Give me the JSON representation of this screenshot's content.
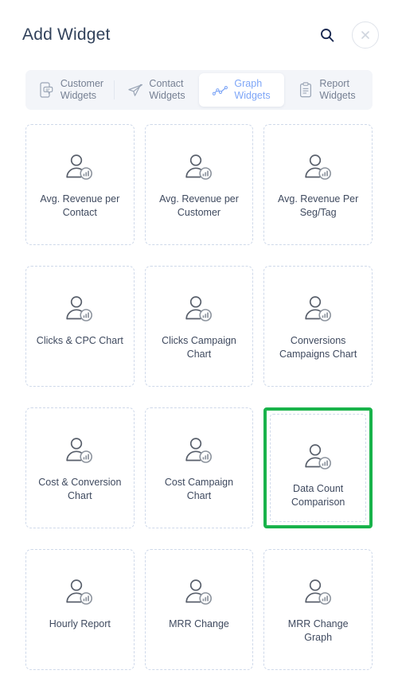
{
  "header": {
    "title": "Add Widget",
    "search_icon": "search-icon",
    "close_icon": "close-icon"
  },
  "tabs": {
    "active_index": 2,
    "items": [
      {
        "label": "Customer\nWidgets",
        "icon": "mobile-chat-icon",
        "active": false
      },
      {
        "label": "Contact\nWidgets",
        "icon": "paper-plane-icon",
        "active": false
      },
      {
        "label": "Graph\nWidgets",
        "icon": "line-chart-icon",
        "active": true
      },
      {
        "label": "Report\nWidgets",
        "icon": "clipboard-icon",
        "active": false
      }
    ]
  },
  "grid": {
    "card_icon": "user-chart-icon",
    "selected_label": "Data Count\nComparison",
    "cards": [
      {
        "label": "Avg. Revenue per\nContact",
        "selected": false
      },
      {
        "label": "Avg. Revenue per\nCustomer",
        "selected": false
      },
      {
        "label": "Avg. Revenue Per\nSeg/Tag",
        "selected": false
      },
      {
        "label": "Clicks & CPC Chart",
        "selected": false
      },
      {
        "label": "Clicks Campaign\nChart",
        "selected": false
      },
      {
        "label": "Conversions\nCampaigns Chart",
        "selected": false
      },
      {
        "label": "Cost & Conversion\nChart",
        "selected": false
      },
      {
        "label": "Cost Campaign\nChart",
        "selected": false
      },
      {
        "label": "Data Count\nComparison",
        "selected": true
      },
      {
        "label": "Hourly Report",
        "selected": false
      },
      {
        "label": "MRR Change",
        "selected": false
      },
      {
        "label": "MRR Change\nGraph",
        "selected": false
      }
    ]
  },
  "colors": {
    "accent_blue": "#7ea6f7",
    "selected_green": "#19b34b",
    "title_text": "#32425b",
    "label_text": "#3f4a5f",
    "tab_bar_bg": "#f3f5f9",
    "card_border": "#cfd9ea"
  }
}
